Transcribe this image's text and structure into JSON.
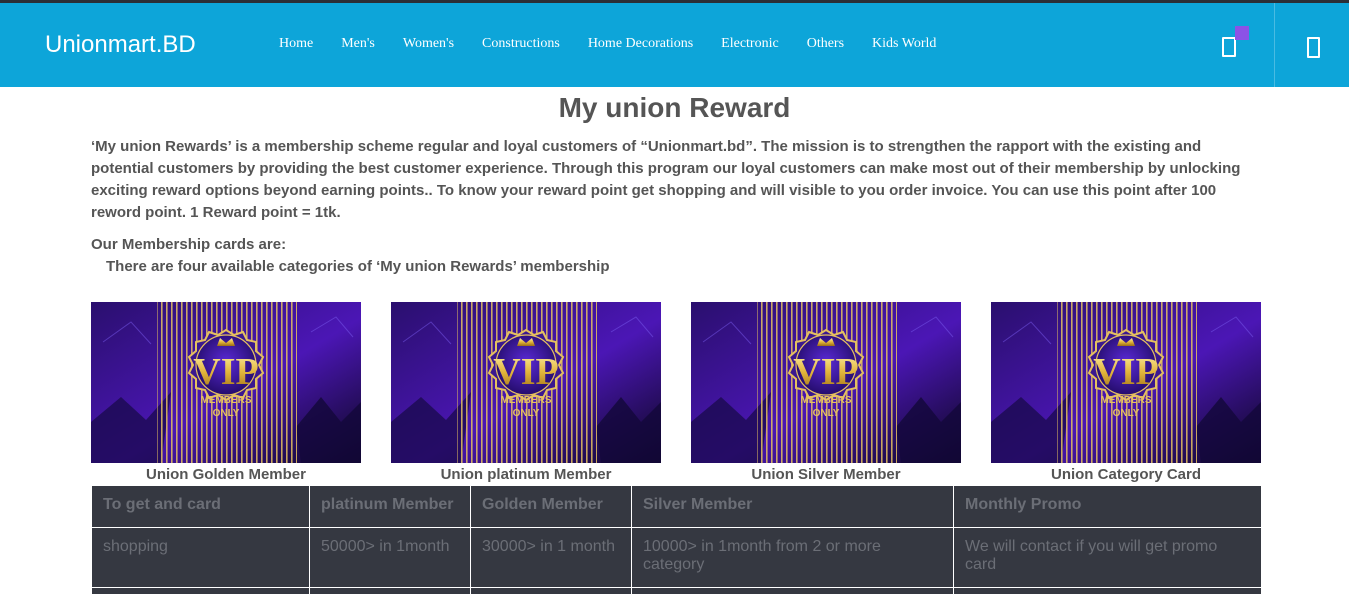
{
  "header": {
    "brand": "Unionmart.BD",
    "nav": [
      "Home",
      "Men's",
      "Women's",
      "Constructions",
      "Home Decorations",
      "Electronic",
      "Others",
      "Kids World"
    ],
    "icons": [
      "cart-icon",
      "user-icon"
    ],
    "accent_color": "#0da5d9",
    "badge_color": "#8c52e6"
  },
  "main": {
    "title": "My union Reward",
    "intro": "‘My union Rewards’ is a membership scheme regular and loyal customers of “Unionmart.bd”. The mission is to strengthen the rapport with the existing and potential customers by providing the best customer experience. Through this program our loyal customers can make most out of their membership by unlocking exciting reward options beyond earning points.. To know your reward point get shopping and will visible to you order invoice. You can use this point after 100 reword point. 1 Reward point = 1tk.",
    "cards_heading": "Our Membership cards are:",
    "cards_sub": "There are four available categories of ‘My union Rewards’ membership",
    "cards": [
      {
        "label": "Union Golden Member",
        "badge_title": "VIP",
        "badge_line1": "MEMBERS",
        "badge_line2": "ONLY"
      },
      {
        "label": "Union platinum Member",
        "badge_title": "VIP",
        "badge_line1": "MEMBERS",
        "badge_line2": "ONLY"
      },
      {
        "label": "Union Silver Member",
        "badge_title": "VIP",
        "badge_line1": "MEMBERS",
        "badge_line2": "ONLY"
      },
      {
        "label": "Union Category Card",
        "badge_title": "VIP",
        "badge_line1": "MEMBERS",
        "badge_line2": "ONLY"
      }
    ],
    "table": {
      "headers": [
        "To get and card",
        "platinum Member",
        "Golden Member",
        "Silver Member",
        "Monthly Promo"
      ],
      "rows": [
        [
          "shopping",
          "50000> in 1month",
          "30000> in 1 month",
          "10000> in 1month from 2 or more category",
          "We will contact if you will get promo card"
        ]
      ]
    }
  }
}
